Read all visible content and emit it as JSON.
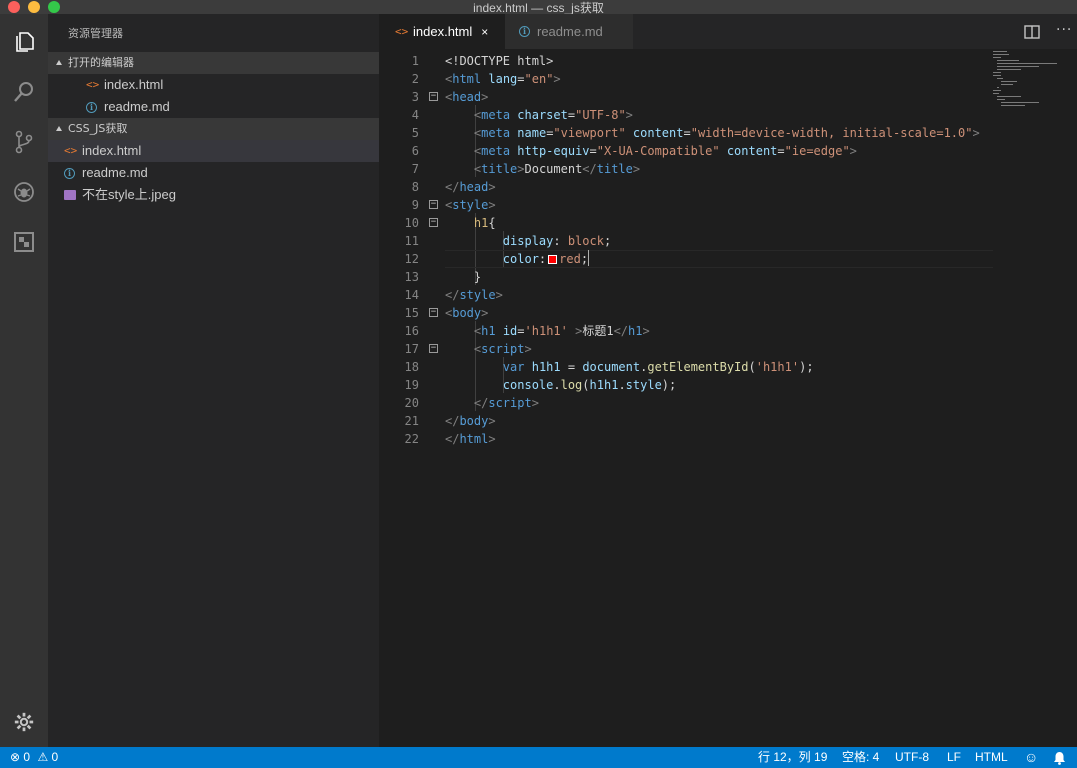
{
  "window": {
    "title": "index.html — css_js获取"
  },
  "activity_bar": {
    "icons": [
      "explorer-icon",
      "search-icon",
      "source-control-icon",
      "debug-icon",
      "extensions-icon",
      "settings-gear-icon"
    ]
  },
  "sidebar": {
    "title": "资源管理器",
    "open_editors": {
      "label": "打开的编辑器",
      "items": [
        {
          "icon": "html-file-icon",
          "label": "index.html"
        },
        {
          "icon": "info-icon",
          "label": "readme.md"
        }
      ]
    },
    "folder": {
      "label": "CSS_JS获取",
      "items": [
        {
          "icon": "html-file-icon",
          "label": "index.html"
        },
        {
          "icon": "info-icon",
          "label": "readme.md"
        },
        {
          "icon": "image-file-icon",
          "label": "不在style上.jpeg"
        }
      ]
    }
  },
  "tabs": [
    {
      "label": "index.html",
      "icon": "html-file-icon",
      "active": true,
      "close": "×"
    },
    {
      "label": "readme.md",
      "icon": "info-icon",
      "active": false
    }
  ],
  "editor": {
    "lines": [
      {
        "n": "1"
      },
      {
        "n": "2"
      },
      {
        "n": "3"
      },
      {
        "n": "4"
      },
      {
        "n": "5"
      },
      {
        "n": "6"
      },
      {
        "n": "7"
      },
      {
        "n": "8"
      },
      {
        "n": "9"
      },
      {
        "n": "10"
      },
      {
        "n": "11"
      },
      {
        "n": "12"
      },
      {
        "n": "13"
      },
      {
        "n": "14"
      },
      {
        "n": "15"
      },
      {
        "n": "16"
      },
      {
        "n": "17"
      },
      {
        "n": "18"
      },
      {
        "n": "19"
      },
      {
        "n": "20"
      },
      {
        "n": "21"
      },
      {
        "n": "22"
      }
    ],
    "code": {
      "l1": [
        "<!DOCTYPE html>"
      ],
      "l2": [
        "<",
        "html",
        " ",
        "lang",
        "=",
        "\"en\"",
        ">"
      ],
      "l3": [
        "<",
        "head",
        ">"
      ],
      "l4": [
        "    ",
        "<",
        "meta",
        " ",
        "charset",
        "=",
        "\"UTF-8\"",
        ">"
      ],
      "l5": [
        "    ",
        "<",
        "meta",
        " ",
        "name",
        "=",
        "\"viewport\"",
        " ",
        "content",
        "=",
        "\"width=device-width, initial-scale=1.0\"",
        ">"
      ],
      "l6": [
        "    ",
        "<",
        "meta",
        " ",
        "http-equiv",
        "=",
        "\"X-UA-Compatible\"",
        " ",
        "content",
        "=",
        "\"ie=edge\"",
        ">"
      ],
      "l7": [
        "    ",
        "<",
        "title",
        ">",
        "Document",
        "</",
        "title",
        ">"
      ],
      "l8": [
        "</",
        "head",
        ">"
      ],
      "l9": [
        "<",
        "style",
        ">"
      ],
      "l10": [
        "    ",
        "h1",
        "{"
      ],
      "l11": [
        "        ",
        "display",
        ": ",
        "block",
        ";"
      ],
      "l12": [
        "        ",
        "color",
        ":",
        "red",
        ";"
      ],
      "l13": [
        "    ",
        "}"
      ],
      "l14": [
        "</",
        "style",
        ">"
      ],
      "l15": [
        "<",
        "body",
        ">"
      ],
      "l16": [
        "    ",
        "<",
        "h1",
        " ",
        "id",
        "=",
        "'h1h1'",
        " >",
        "标题1",
        "</",
        "h1",
        ">"
      ],
      "l17": [
        "    ",
        "<",
        "script",
        ">"
      ],
      "l18": [
        "        ",
        "var",
        " ",
        "h1h1",
        " = ",
        "document",
        ".",
        "getElementById",
        "(",
        "'h1h1'",
        ");"
      ],
      "l19": [
        "        ",
        "console",
        ".",
        "log",
        "(",
        "h1h1",
        ".",
        "style",
        ");"
      ],
      "l20": [
        "    ",
        "</",
        "script",
        ">"
      ],
      "l21": [
        "</",
        "body",
        ">"
      ],
      "l22": [
        "</",
        "html",
        ">"
      ]
    },
    "color_swatch": "#ff0000"
  },
  "status_bar": {
    "errors": "0",
    "warnings": "0",
    "position": "行 12，列 19",
    "spaces": "空格: 4",
    "encoding": "UTF-8",
    "eol": "LF",
    "language": "HTML"
  },
  "colors": {
    "status_bar": "#007acc",
    "tag_bracket": "#808080",
    "tag_name": "#569cd6",
    "attr_name": "#9cdcfe",
    "string": "#ce9178",
    "selector": "#d7ba7d",
    "css_value": "#ce9178",
    "js_keyword": "#569cd6",
    "js_function": "#dcdcaa",
    "js_variable": "#9cdcfe"
  }
}
